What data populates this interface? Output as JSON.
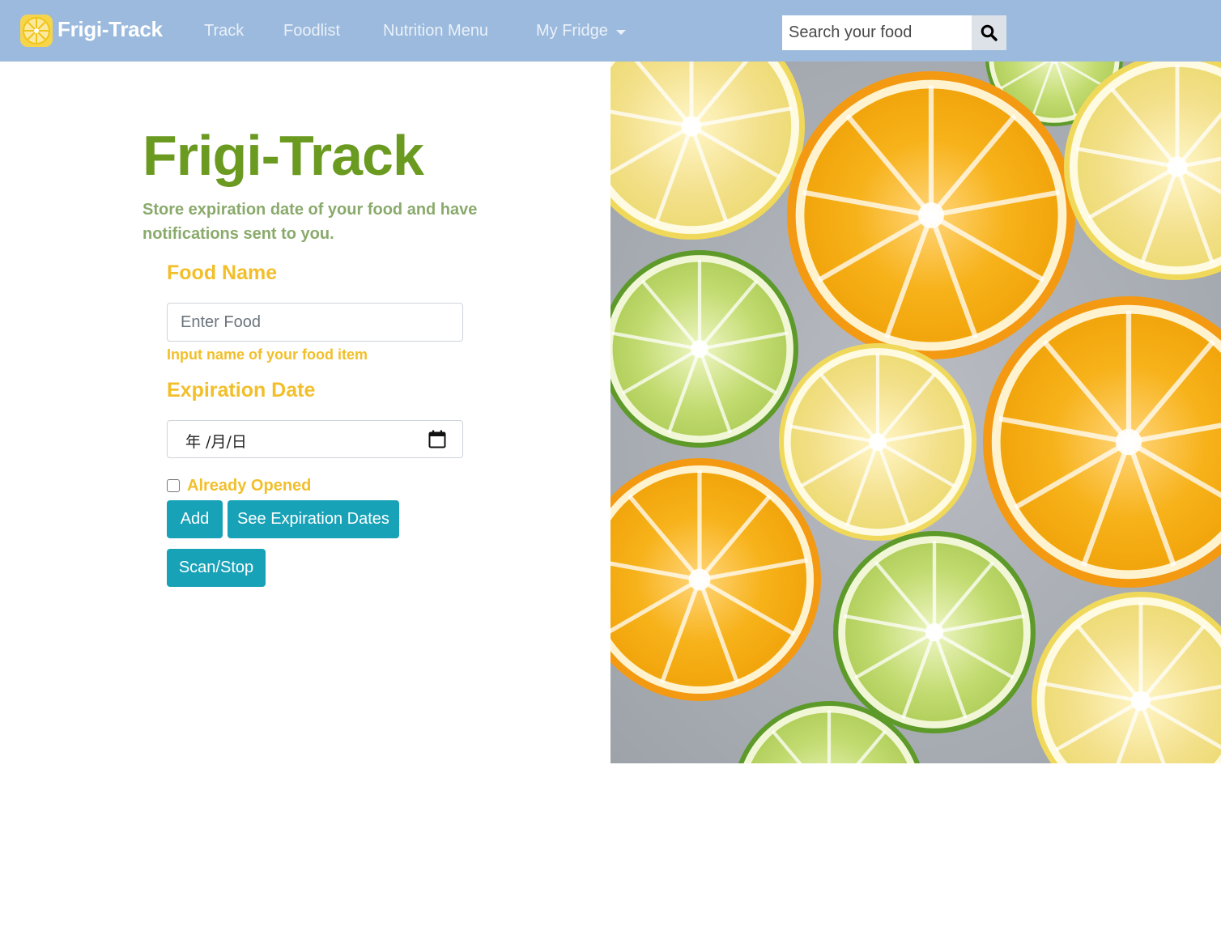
{
  "navbar": {
    "brand": "Frigi-Track",
    "links": [
      {
        "label": "Track"
      },
      {
        "label": "Foodlist"
      },
      {
        "label": "Nutrition Menu"
      },
      {
        "label": "My Fridge"
      }
    ],
    "search": {
      "placeholder": "Search your food",
      "value": ""
    },
    "icons": {
      "logo": "lemon-slice-icon",
      "search": "search-icon",
      "dropdown": "caret-down-icon"
    },
    "colors": {
      "background": "#9cbadd",
      "link": "#eaf1f9"
    }
  },
  "hero": {
    "title": "Frigi-Track",
    "subtitle": "Store expiration date of your food and have notifications sent to you."
  },
  "form": {
    "food_label": "Food Name",
    "food_placeholder": "Enter Food",
    "food_value": "",
    "food_help": "Input name of your food item",
    "expiration_label": "Expiration Date",
    "date_placeholder": "年 /月/日",
    "calendar_icon": "calendar-icon",
    "checkbox_label": "Already Opened",
    "checkbox_checked": false,
    "buttons": {
      "add": "Add",
      "see_dates": "See Expiration Dates",
      "scan": "Scan/Stop"
    }
  },
  "colors": {
    "title": "#6b9a21",
    "subtitle": "#8aaa6c",
    "label": "#f2bf2a",
    "button": "#17a2b8"
  },
  "image": {
    "subject": "citrus-slices-photo"
  }
}
